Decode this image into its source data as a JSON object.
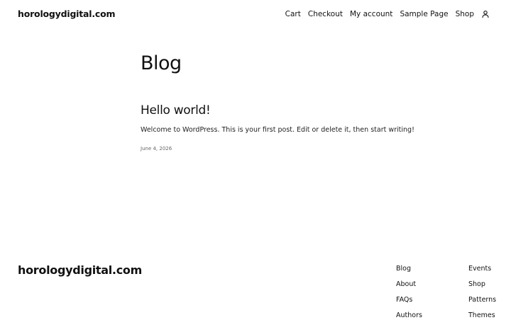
{
  "header": {
    "site_title": "horologydigital.com",
    "nav": {
      "cart": "Cart",
      "checkout": "Checkout",
      "my_account": "My account",
      "sample_page": "Sample Page",
      "shop": "Shop"
    },
    "account_icon": "user-icon"
  },
  "main": {
    "title": "Blog",
    "post": {
      "title": "Hello world!",
      "excerpt": "Welcome to WordPress. This is your first post. Edit or delete it, then start writing!",
      "date": "June 4, 2026"
    }
  },
  "footer": {
    "site_title": "horologydigital.com",
    "column1": [
      "Blog",
      "About",
      "FAQs",
      "Authors"
    ],
    "column2": [
      "Events",
      "Shop",
      "Patterns",
      "Themes"
    ]
  }
}
